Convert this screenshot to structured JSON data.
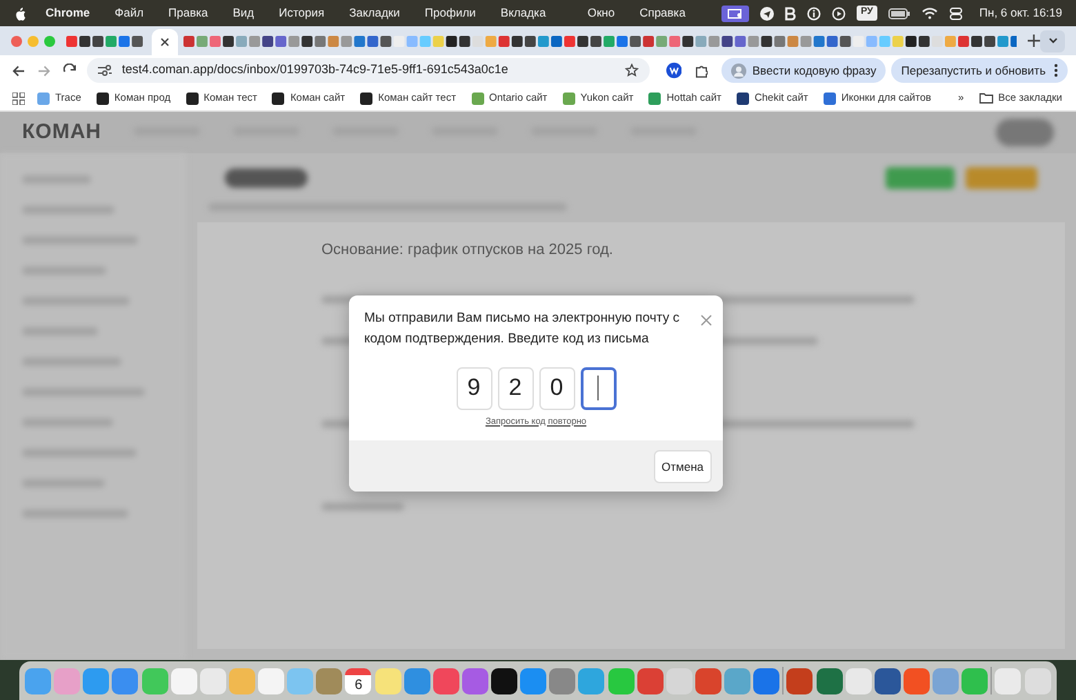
{
  "menu_bar": {
    "app": "Chrome",
    "items": [
      "Файл",
      "Правка",
      "Вид",
      "История",
      "Закладки",
      "Профили",
      "Вкладка",
      "Окно",
      "Справка"
    ],
    "input_source": "РУ",
    "clock": "Пн, 6 окт. 16:19"
  },
  "browser": {
    "url": "test4.coman.app/docs/inbox/0199703b-74c9-71e5-9ff1-691c543a0c1e",
    "profile_button": "Ввести кодовую фразу",
    "update_button": "Перезапустить и обновить",
    "bookmarks": [
      {
        "label": "Trace",
        "color": "#6aa7e8"
      },
      {
        "label": "Коман прод",
        "color": "#222222"
      },
      {
        "label": "Коман тест",
        "color": "#222222"
      },
      {
        "label": "Коман сайт",
        "color": "#222222"
      },
      {
        "label": "Коман сайт тест",
        "color": "#222222"
      },
      {
        "label": "Ontario сайт",
        "color": "#6aa84f"
      },
      {
        "label": "Yukon сайт",
        "color": "#6aa84f"
      },
      {
        "label": "Hottah сайт",
        "color": "#2e9e5b"
      },
      {
        "label": "Chekit сайт",
        "color": "#1f3b73"
      },
      {
        "label": "Иконки для сайтов",
        "color": "#2f6fd6"
      }
    ],
    "more_bookmarks": "»",
    "all_bookmarks": "Все закладки"
  },
  "app": {
    "logo": "КОМАН",
    "document_heading": "Основание: график отпусков на 2025 год."
  },
  "dialog": {
    "message": "Мы отправили Вам письмо на электронную почту с кодом подтверждения. Введите код из письма",
    "code_cells": [
      {
        "value": "9",
        "focused": false
      },
      {
        "value": "2",
        "focused": false
      },
      {
        "value": "0",
        "focused": false
      },
      {
        "focused": true
      }
    ],
    "resend_link": "Запросить код повторно",
    "cancel_button": "Отмена"
  },
  "dock": {
    "calendar_day": "6"
  }
}
